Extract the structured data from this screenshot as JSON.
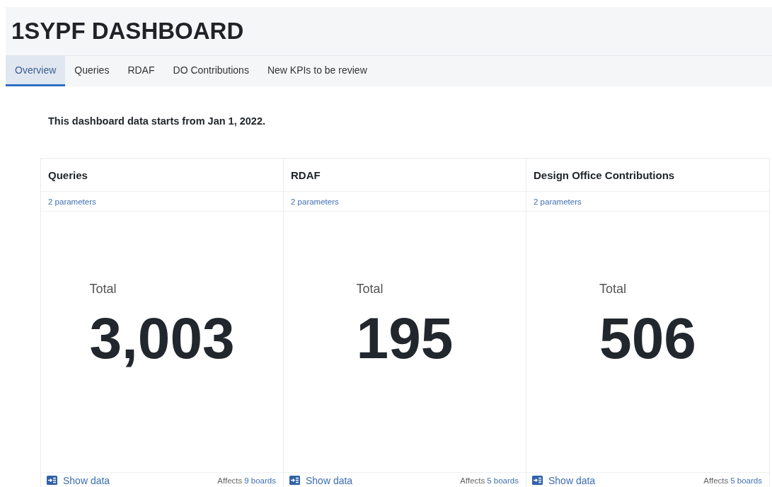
{
  "title": "1SYPF DASHBOARD",
  "tabs": [
    {
      "label": "Overview",
      "selected": true
    },
    {
      "label": "Queries",
      "selected": false
    },
    {
      "label": "RDAF",
      "selected": false
    },
    {
      "label": "DO Contributions",
      "selected": false
    },
    {
      "label": "New KPIs to be review",
      "selected": false
    }
  ],
  "note": "This dashboard data starts from Jan 1, 2022.",
  "cards": [
    {
      "title": "Queries",
      "parameters": "2 parameters",
      "metric_label": "Total",
      "value": "3,003",
      "show_data": "Show data",
      "affects_label": "Affects",
      "affects_link": "9 boards"
    },
    {
      "title": "RDAF",
      "parameters": "2 parameters",
      "metric_label": "Total",
      "value": "195",
      "show_data": "Show data",
      "affects_label": "Affects",
      "affects_link": "5 boards"
    },
    {
      "title": "Design Office Contributions",
      "parameters": "2 parameters",
      "metric_label": "Total",
      "value": "506",
      "show_data": "Show data",
      "affects_label": "Affects",
      "affects_link": "5 boards"
    }
  ]
}
